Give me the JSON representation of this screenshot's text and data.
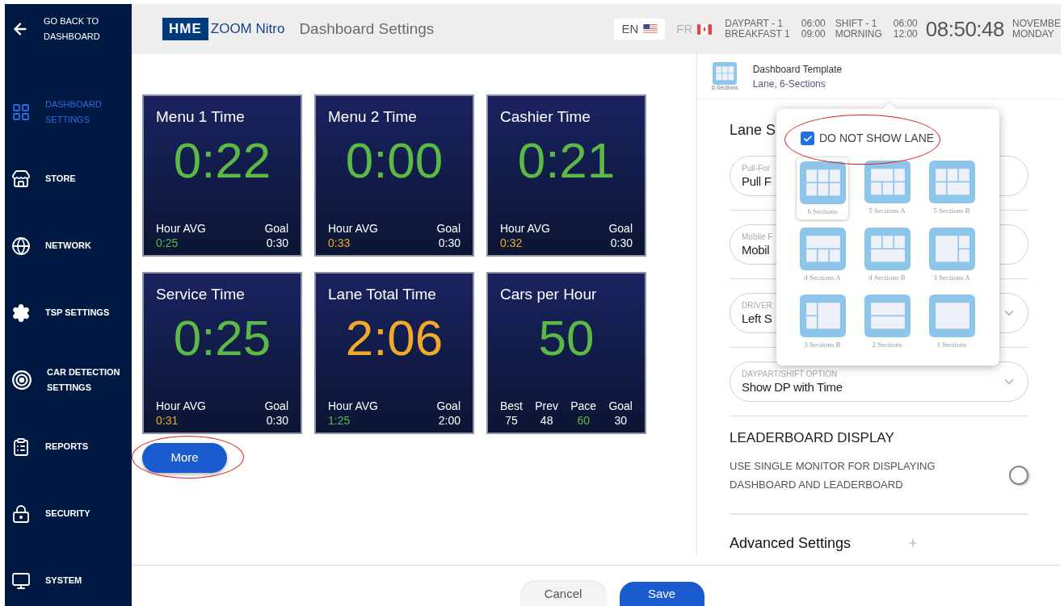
{
  "sidebar": {
    "back": "GO BACK TO DASHBOARD",
    "items": [
      {
        "label": "DASHBOARD SETTINGS",
        "selected": true
      },
      {
        "label": "STORE",
        "selected": false
      },
      {
        "label": "NETWORK",
        "selected": false
      },
      {
        "label": "TSP SETTINGS",
        "selected": false
      },
      {
        "label": "CAR DETECTION SETTINGS",
        "selected": false
      },
      {
        "label": "REPORTS",
        "selected": false
      },
      {
        "label": "SECURITY",
        "selected": false
      },
      {
        "label": "SYSTEM",
        "selected": false
      }
    ]
  },
  "header": {
    "logo": {
      "mark": "HME",
      "name": "ZOOM Nitro"
    },
    "title": "Dashboard Settings",
    "languages": [
      {
        "code": "EN",
        "selected": true
      },
      {
        "code": "FR",
        "selected": false
      }
    ],
    "dayparts": [
      {
        "name": "DAYPART - 1",
        "period": "BREAKFAST 1",
        "start": "06:00",
        "end": "09:00"
      },
      {
        "name": "SHIFT - 1",
        "period": "MORNING",
        "start": "06:00",
        "end": "12:00"
      }
    ],
    "clock": "08:50:48",
    "date": "NOVEMBE",
    "day": "MONDAY"
  },
  "tiles": [
    {
      "kind": "avg_goal",
      "title": "Menu 1 Time",
      "value": "0:22",
      "color": "#5cb946",
      "stats": [
        {
          "label": "Hour AVG",
          "value": "0:25",
          "color": "#5cb946"
        },
        {
          "label": "Goal",
          "value": "0:30",
          "color": "#ffffff"
        }
      ]
    },
    {
      "kind": "avg_goal",
      "title": "Menu 2 Time",
      "value": "0:00",
      "color": "#5cb946",
      "stats": [
        {
          "label": "Hour AVG",
          "value": "0:33",
          "color": "#f0a92a"
        },
        {
          "label": "Goal",
          "value": "0:30",
          "color": "#ffffff"
        }
      ]
    },
    {
      "kind": "avg_goal",
      "title": "Cashier Time",
      "value": "0:21",
      "color": "#5cb946",
      "stats": [
        {
          "label": "Hour AVG",
          "value": "0:32",
          "color": "#f0a92a"
        },
        {
          "label": "Goal",
          "value": "0:30",
          "color": "#ffffff"
        }
      ]
    },
    {
      "kind": "avg_goal",
      "title": "Service Time",
      "value": "0:25",
      "color": "#5cb946",
      "stats": [
        {
          "label": "Hour AVG",
          "value": "0:31",
          "color": "#f0a92a"
        },
        {
          "label": "Goal",
          "value": "0:30",
          "color": "#ffffff"
        }
      ]
    },
    {
      "kind": "avg_goal",
      "title": "Lane Total Time",
      "value": "2:06",
      "color": "#f0a92a",
      "stats": [
        {
          "label": "Hour AVG",
          "value": "1:25",
          "color": "#5cb946"
        },
        {
          "label": "Goal",
          "value": "2:00",
          "color": "#ffffff"
        }
      ]
    },
    {
      "kind": "stats",
      "title": "Cars per Hour",
      "value": "50",
      "color": "#5cb946",
      "stats": [
        {
          "label": "Best",
          "value": "75",
          "color": "#ffffff"
        },
        {
          "label": "Prev",
          "value": "48",
          "color": "#ffffff"
        },
        {
          "label": "Pace",
          "value": "60",
          "color": "#5cb946"
        },
        {
          "label": "Goal",
          "value": "30",
          "color": "#ffffff"
        }
      ]
    }
  ],
  "more_button": "More",
  "template": {
    "icon_label": "6 Sections",
    "title": "Dashboard Template",
    "value": "Lane, 6-Sections"
  },
  "section_title": "Lane S",
  "fields": [
    {
      "kind": "text",
      "label": "Pull-For",
      "value": "Pull F"
    },
    {
      "kind": "text",
      "label": "Mobile F",
      "value": "Mobil"
    },
    {
      "kind": "select",
      "label": "DRIVER",
      "value": "Left S"
    },
    {
      "kind": "select",
      "label": "DAYPART/SHIFT OPTION",
      "value": "Show DP with Time"
    }
  ],
  "leaderboard": {
    "title": "LEADERBOARD DISPLAY",
    "option": "USE SINGLE MONITOR FOR DISPLAYING DASHBOARD AND LEADERBOARD",
    "on": false
  },
  "advanced": "Advanced Settings",
  "popup": {
    "checkbox": {
      "label": "DO NOT SHOW LANE",
      "checked": true
    },
    "templates": [
      {
        "name": "6 Sections",
        "kind": "six",
        "selected": true
      },
      {
        "name": "5 Sections A",
        "kind": "five_a",
        "selected": false
      },
      {
        "name": "5 Sections B",
        "kind": "five_b",
        "selected": false
      },
      {
        "name": "4 Sections A",
        "kind": "four_a",
        "selected": false
      },
      {
        "name": "4 Sections B",
        "kind": "four_b",
        "selected": false
      },
      {
        "name": "3 Sections A",
        "kind": "three_a",
        "selected": false
      },
      {
        "name": "3 Sections B",
        "kind": "three_b",
        "selected": false
      },
      {
        "name": "2 Sections",
        "kind": "two",
        "selected": false
      },
      {
        "name": "1 Sections",
        "kind": "one",
        "selected": false
      }
    ]
  },
  "footer": [
    {
      "label": "Cancel",
      "kind": "secondary"
    },
    {
      "label": "Save",
      "kind": "primary"
    }
  ]
}
